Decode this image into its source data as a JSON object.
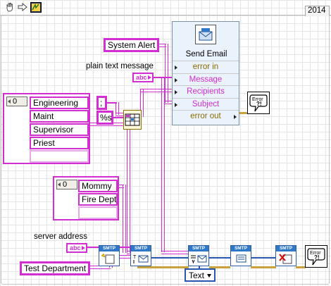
{
  "toolbar": {
    "hand_icon": "hand-icon",
    "arrow_icon": "run-arrow-icon",
    "vi_icon": "vi-icon"
  },
  "version_label": "2014",
  "diagram": {
    "system_alert": "System Alert",
    "plain_text_label": "plain text message",
    "abc_tag": "abc",
    "semicolon": ";",
    "format_spec": "%s",
    "array1": {
      "index": "0",
      "items": [
        "Engineering",
        "Maint",
        "Supervisor",
        "Priest",
        ""
      ]
    },
    "array2": {
      "index": "0",
      "items": [
        "Mommy",
        "Fire Dept",
        ""
      ]
    },
    "server_label": "server address",
    "server_abc": "abc",
    "test_department": "Test Department",
    "text_enum": "Text",
    "smtp_tag": "SMTP",
    "error_tag": "Error",
    "send_email": {
      "title": "Send Email",
      "rows": [
        "error in",
        "Message",
        "Recipients",
        "Subject",
        "error out"
      ]
    }
  },
  "colors": {
    "string_wire": "#d22ed2",
    "cluster_wire": "#c8a23a",
    "smtp_wire": "#2956b2",
    "panel_bg": "#eaf2fb"
  }
}
